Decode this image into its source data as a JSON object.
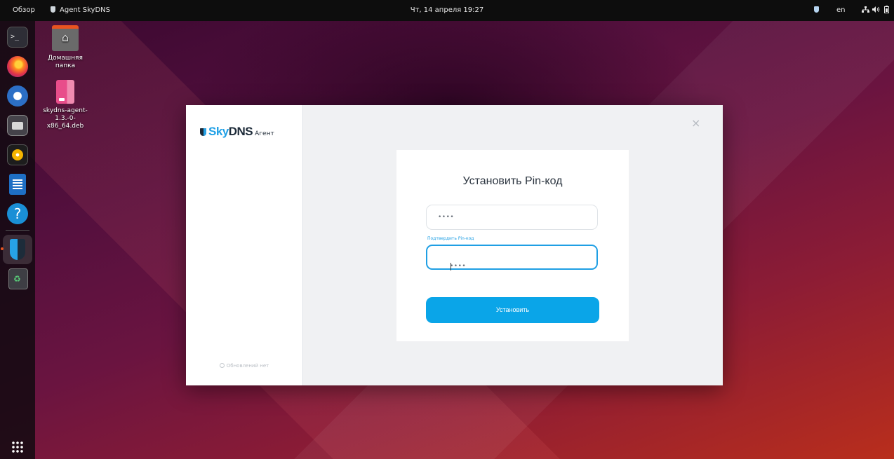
{
  "topbar": {
    "overview": "Обзор",
    "app_name": "Agent SkyDNS",
    "clock": "Чт, 14 апреля 19:27",
    "language": "en",
    "icons": [
      "skydns-shield-icon",
      "network-icon",
      "volume-icon",
      "battery-icon"
    ]
  },
  "dock": {
    "items": [
      "terminal-icon",
      "firefox-icon",
      "thunderbird-icon",
      "files-icon",
      "rhythmbox-icon",
      "writer-icon",
      "help-icon",
      "skydns-agent-icon",
      "trash-icon",
      "show-apps-icon"
    ],
    "terminal_glyph": ">_",
    "help_glyph": "?"
  },
  "desktop": {
    "home_label": "Домашняя папка",
    "deb_label": "skydns-agent-1.3.-0-x86_64.deb"
  },
  "dialog": {
    "logo_sky": "Sky",
    "logo_dns": "DNS",
    "logo_agent": "Агент",
    "updates": "Обновлений нет",
    "close_glyph": "×",
    "title": "Установить Pin-код",
    "pin_value": "••••",
    "confirm_label": "Подтвердить Pin-код",
    "confirm_value": "••••",
    "submit_label": "Установить"
  },
  "colors": {
    "accent": "#0aa5e8",
    "focus_border": "#1f9fe4",
    "ubuntu_orange": "#e95420"
  }
}
